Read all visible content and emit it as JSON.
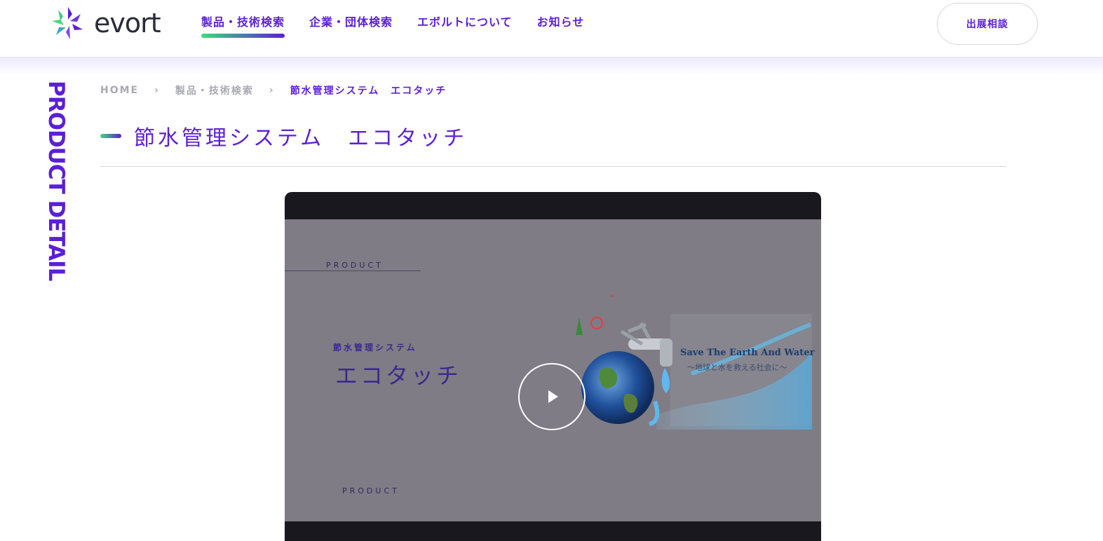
{
  "header": {
    "logo_text": "evort",
    "nav": [
      {
        "label": "製品・技術検索",
        "active": true
      },
      {
        "label": "企業・団体検索",
        "active": false
      },
      {
        "label": "エボルトについて",
        "active": false
      },
      {
        "label": "お知らせ",
        "active": false
      }
    ],
    "expo_button": "出展相談"
  },
  "side_label": "PRODUCT DETAIL",
  "breadcrumb": {
    "home": "HOME",
    "category": "製品・技術検索",
    "current": "節水管理システム　エコタッチ"
  },
  "page_title": "節水管理システム　エコタッチ",
  "video": {
    "label_top": "PRODUCT",
    "subtitle": "節水管理システム",
    "title": "エコタッチ",
    "label_bottom": "PRODUCT",
    "tagline_en": "Save The Earth And Water",
    "tagline_jp": "〜地球と水を救える社会に〜"
  },
  "colors": {
    "brand_purple": "#5b1fd6",
    "brand_green": "#3ddc7a",
    "video_dark": "#1a181f",
    "video_overlay": "#7f7c86"
  },
  "icons": {
    "play": "play-icon",
    "chevron": "chevron-right-icon",
    "logo": "evort-logo-icon"
  }
}
